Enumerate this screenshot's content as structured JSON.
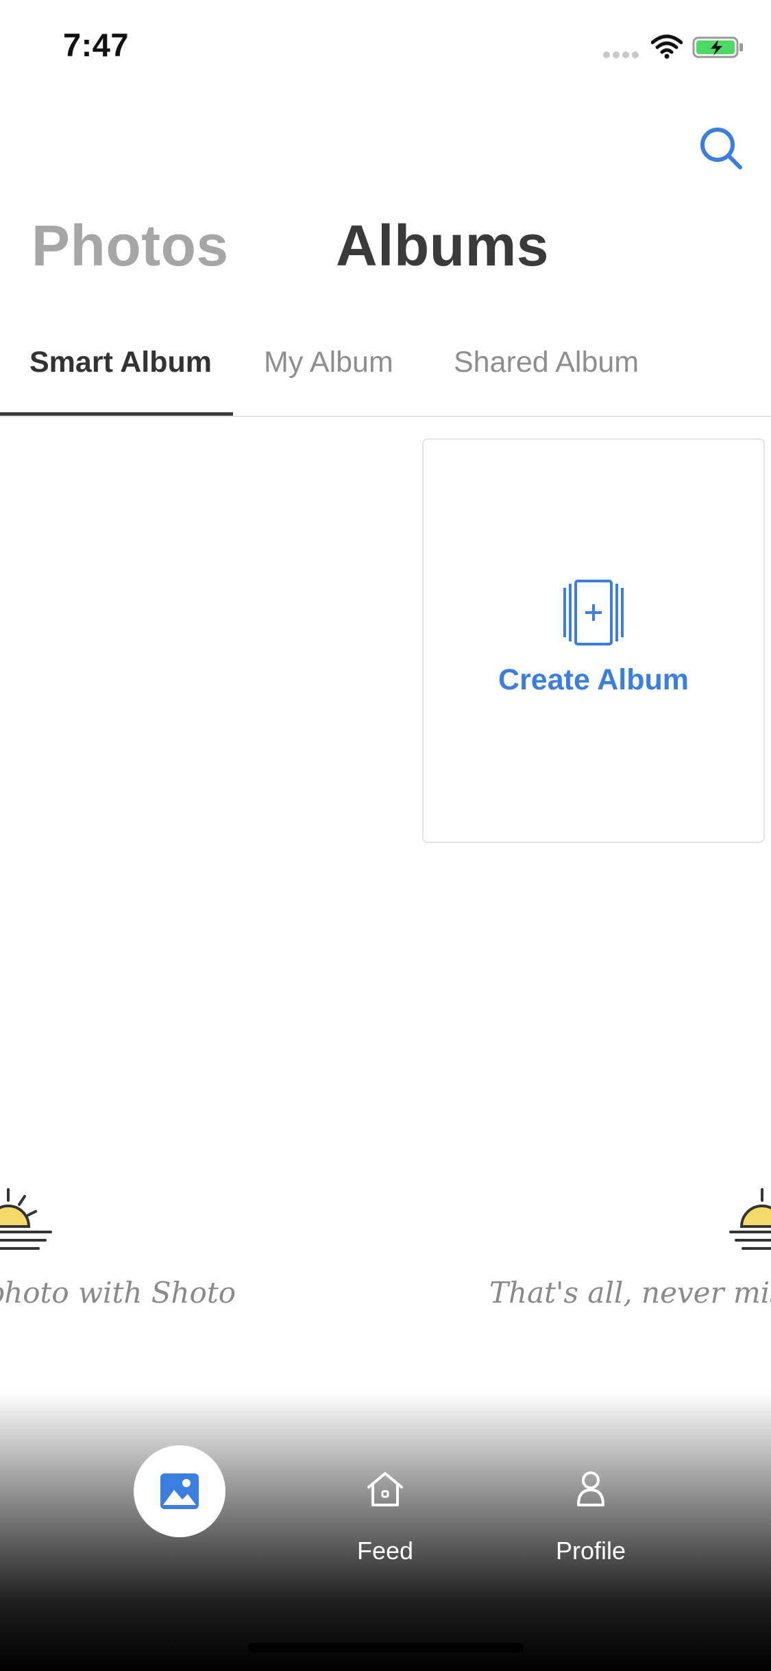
{
  "status_bar": {
    "time": "7:47"
  },
  "header": {
    "search_icon": "search-icon",
    "tabs": [
      {
        "label": "Photos",
        "active": false
      },
      {
        "label": "Albums",
        "active": true
      }
    ]
  },
  "sub_tabs": {
    "items": [
      {
        "label": "Smart Album",
        "active": true
      },
      {
        "label": "My Album",
        "active": false
      },
      {
        "label": "Shared Album",
        "active": false
      }
    ]
  },
  "create_album": {
    "label": "Create Album",
    "icon": "add-album-icon"
  },
  "carousel": {
    "slides": [
      {
        "icon": "sunrise-icon",
        "text": "s a photo with Shoto"
      },
      {
        "icon": "sunrise-icon",
        "text": "That's all, never miss"
      }
    ]
  },
  "bottom_nav": {
    "items": [
      {
        "icon": "photo-icon",
        "label": "",
        "active": true
      },
      {
        "icon": "home-icon",
        "label": "Feed",
        "active": false
      },
      {
        "icon": "person-icon",
        "label": "Profile",
        "active": false
      }
    ]
  },
  "colors": {
    "accent": "#3a7fe0",
    "active_text": "#3a3a3a",
    "inactive_text": "#a6a6a6",
    "sun_yellow": "#f5d96b"
  }
}
